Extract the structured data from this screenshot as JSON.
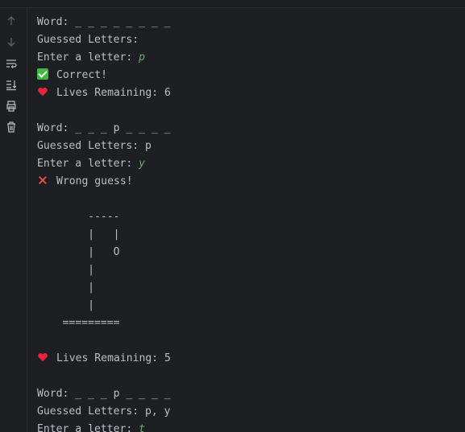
{
  "toolbar": {
    "icons": [
      "up-arrow-icon",
      "down-arrow-icon",
      "soft-wrap-icon",
      "scroll-to-end-icon",
      "print-icon",
      "trash-icon"
    ]
  },
  "console": {
    "lines": [
      {
        "kind": "text",
        "text": "Word: _ _ _ _ _ _ _ _"
      },
      {
        "kind": "text",
        "text": "Guessed Letters:"
      },
      {
        "kind": "prompt",
        "text": "Enter a letter: ",
        "input": "p"
      },
      {
        "kind": "check",
        "text": "Correct!"
      },
      {
        "kind": "heart",
        "text": "Lives Remaining: 6"
      },
      {
        "kind": "blank",
        "text": ""
      },
      {
        "kind": "text",
        "text": "Word: _ _ _ p _ _ _ _"
      },
      {
        "kind": "text",
        "text": "Guessed Letters: p"
      },
      {
        "kind": "prompt",
        "text": "Enter a letter: ",
        "input": "y"
      },
      {
        "kind": "cross",
        "text": "Wrong guess!"
      },
      {
        "kind": "blank",
        "text": ""
      },
      {
        "kind": "text",
        "text": "        -----"
      },
      {
        "kind": "text",
        "text": "        |   |"
      },
      {
        "kind": "text",
        "text": "        |   O"
      },
      {
        "kind": "text",
        "text": "        |"
      },
      {
        "kind": "text",
        "text": "        |"
      },
      {
        "kind": "text",
        "text": "        |"
      },
      {
        "kind": "text",
        "text": "    ========="
      },
      {
        "kind": "blank",
        "text": ""
      },
      {
        "kind": "heart",
        "text": "Lives Remaining: 5"
      },
      {
        "kind": "blank",
        "text": ""
      },
      {
        "kind": "text",
        "text": "Word: _ _ _ p _ _ _ _"
      },
      {
        "kind": "text",
        "text": "Guessed Letters: p, y"
      },
      {
        "kind": "prompt",
        "text": "Enter a letter: ",
        "input": "t"
      }
    ]
  },
  "colors": {
    "background": "#1e1f22",
    "text": "#bcbec4",
    "user_input": "#6aab73",
    "check": "#3fb93f",
    "heart": "#e8243c",
    "cross": "#f24c4c"
  }
}
